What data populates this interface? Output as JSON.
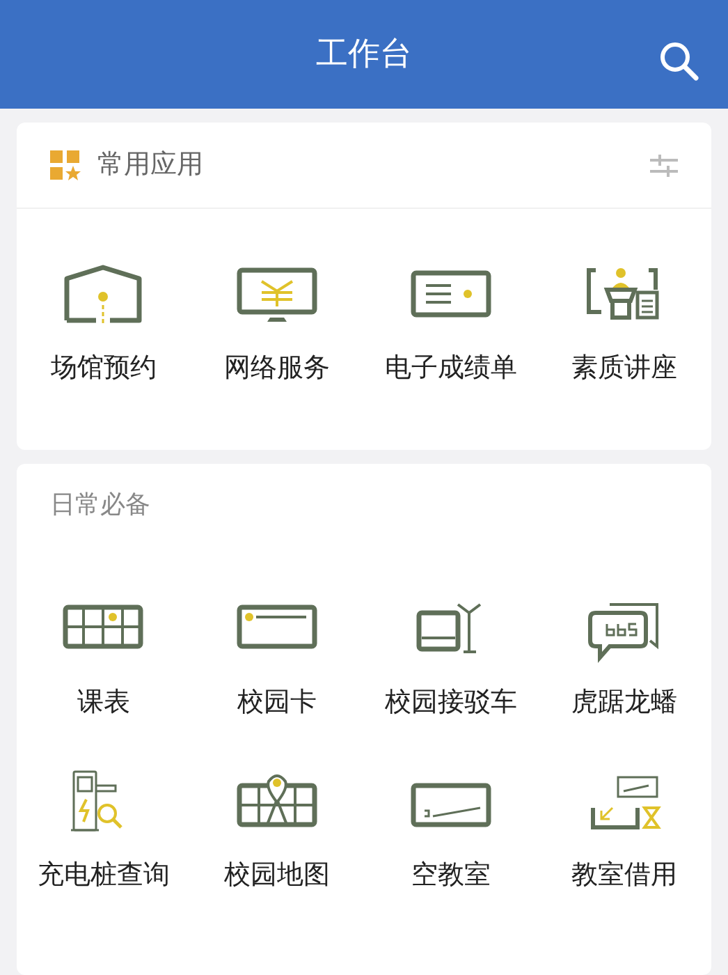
{
  "header": {
    "title": "工作台"
  },
  "favorites": {
    "title": "常用应用",
    "apps": [
      {
        "label": "场馆预约",
        "kind": "venue"
      },
      {
        "label": "网络服务",
        "kind": "network"
      },
      {
        "label": "电子成绩单",
        "kind": "transcript"
      },
      {
        "label": "素质讲座",
        "kind": "lecture"
      }
    ]
  },
  "daily": {
    "title": "日常必备",
    "apps": [
      {
        "label": "课表",
        "kind": "timetable"
      },
      {
        "label": "校园卡",
        "kind": "card"
      },
      {
        "label": "校园接驳车",
        "kind": "bus"
      },
      {
        "label": "虎踞龙蟠",
        "kind": "bbs"
      },
      {
        "label": "充电桩查询",
        "kind": "charger"
      },
      {
        "label": "校园地图",
        "kind": "map"
      },
      {
        "label": "空教室",
        "kind": "room"
      },
      {
        "label": "教室借用",
        "kind": "borrow"
      }
    ]
  }
}
